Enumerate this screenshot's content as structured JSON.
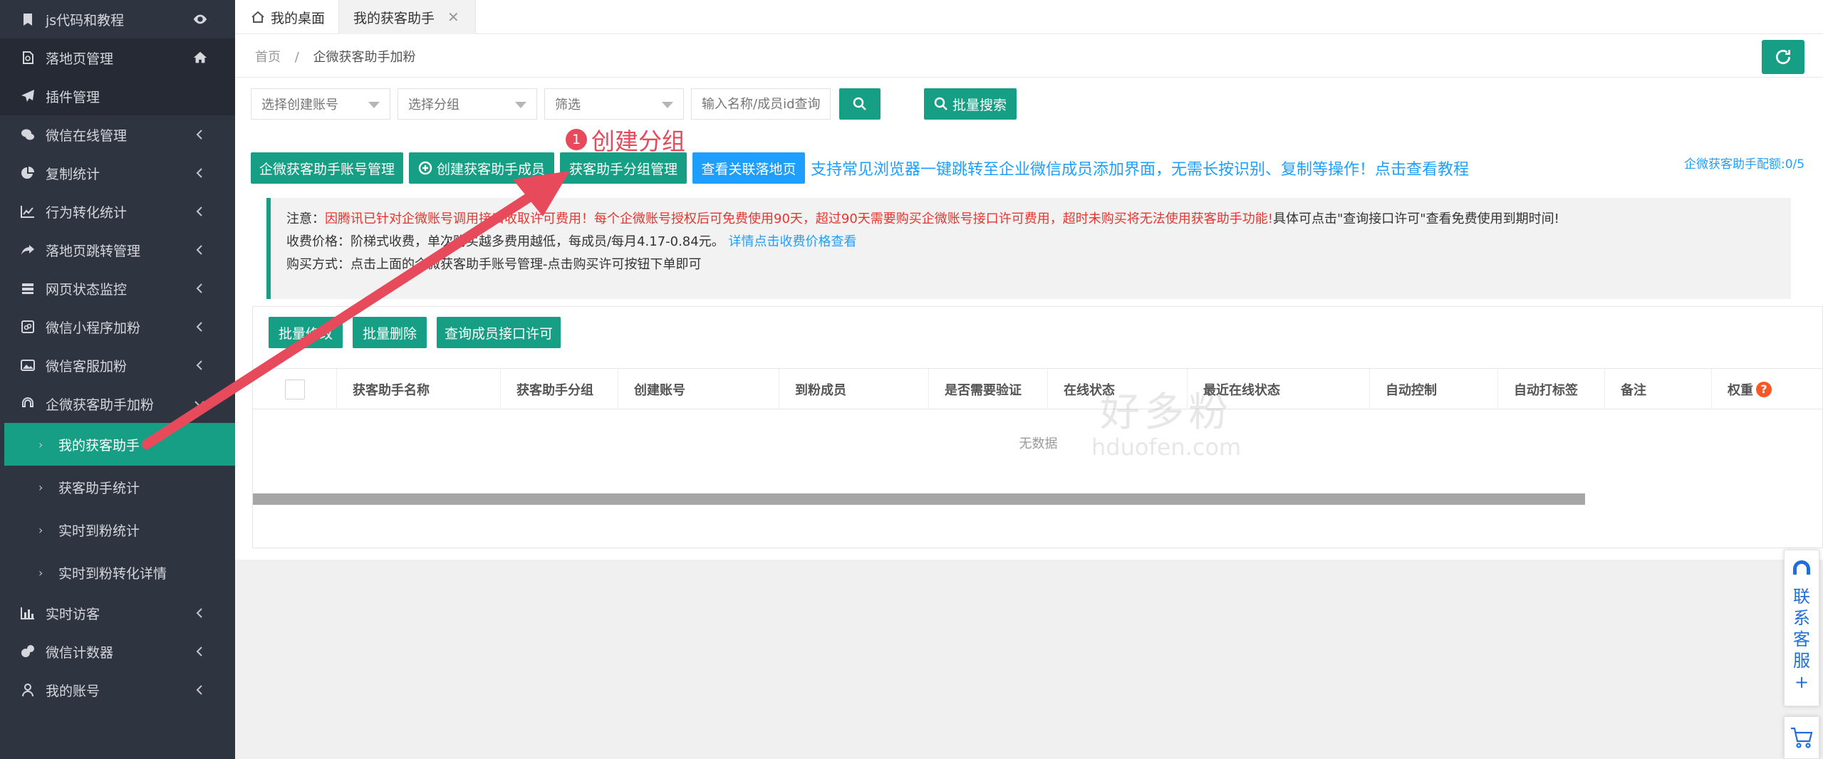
{
  "sidebar": {
    "items": [
      {
        "label": "js代码和教程",
        "icon": "bookmark-icon",
        "right": "eye-icon"
      },
      {
        "label": "落地页管理",
        "icon": "page-icon",
        "right": "home-icon"
      },
      {
        "label": "插件管理",
        "icon": "paper-plane-icon"
      },
      {
        "label": "微信在线管理",
        "icon": "wechat-icon"
      },
      {
        "label": "复制统计",
        "icon": "pie-chart-icon"
      },
      {
        "label": "行为转化统计",
        "icon": "line-chart-icon"
      },
      {
        "label": "落地页跳转管理",
        "icon": "share-icon"
      },
      {
        "label": "网页状态监控",
        "icon": "server-icon"
      },
      {
        "label": "微信小程序加粉",
        "icon": "miniprogram-icon"
      },
      {
        "label": "微信客服加粉",
        "icon": "image-icon"
      },
      {
        "label": "企微获客助手加粉",
        "icon": "headset-icon"
      }
    ],
    "subitems": [
      {
        "label": "我的获客助手"
      },
      {
        "label": "获客助手统计"
      },
      {
        "label": "实时到粉统计"
      },
      {
        "label": "实时到粉转化详情"
      }
    ],
    "bottom_items": [
      {
        "label": "实时访客",
        "icon": "bar-chart-icon"
      },
      {
        "label": "微信计数器",
        "icon": "pie-icon"
      },
      {
        "label": "我的账号",
        "icon": "user-icon"
      }
    ]
  },
  "tabs": {
    "home": "我的桌面",
    "current": "我的获客助手",
    "close": "✕"
  },
  "breadcrumb": {
    "home": "首页",
    "sep": "/",
    "current": "企微获客助手加粉"
  },
  "filters": {
    "account": "选择创建账号",
    "group": "选择分组",
    "filter": "筛选",
    "search_placeholder": "输入名称/成员id查询",
    "batch_search": "批量搜索"
  },
  "actions": {
    "account_manage": "企微获客助手账号管理",
    "create_member": "创建获客助手成员",
    "group_manage": "获客助手分组管理",
    "view_landing": "查看关联落地页",
    "promo": "支持常见浏览器一键跳转至企业微信成员添加界面，无需长按识别、复制等操作！点击查看教程",
    "quota": "企微获客助手配额:0/5"
  },
  "annotation": {
    "number": "1",
    "text": "创建分组"
  },
  "notice": {
    "line1_prefix": "注意：",
    "line1_red": "因腾讯已针对企微账号调用接口收取许可费用！每个企微账号授权后可免费使用90天，超过90天需要购买企微账号接口许可费用，超时未购买将无法使用获客助手功能!",
    "line1_suffix": "具体可点击\"查询接口许可\"查看免费使用到期时间!",
    "line2_prefix": "收费价格：阶梯式收费，单次购买越多费用越低，每成员/每月4.17-0.84元。",
    "line2_link": "详情点击收费价格查看",
    "line3": "购买方式：点击上面的企微获客助手账号管理-点击购买许可按钮下单即可"
  },
  "table": {
    "batch_edit": "批量修改",
    "batch_delete": "批量删除",
    "query_license": "查询成员接口许可",
    "columns": [
      "获客助手名称",
      "获客助手分组",
      "创建账号",
      "到粉成员",
      "是否需要验证",
      "在线状态",
      "最近在线状态",
      "自动控制",
      "自动打标签",
      "备注",
      "权重"
    ],
    "help": "?",
    "empty": "无数据"
  },
  "watermark": {
    "cn": "好多粉",
    "en": "hduofen.com"
  },
  "floating": {
    "service": "联系客服+"
  },
  "colors": {
    "primary": "#169f85",
    "blue": "#1e9fff",
    "sidebar": "#2f3441",
    "annotation": "#e64a5b",
    "danger": "#e4362f"
  }
}
